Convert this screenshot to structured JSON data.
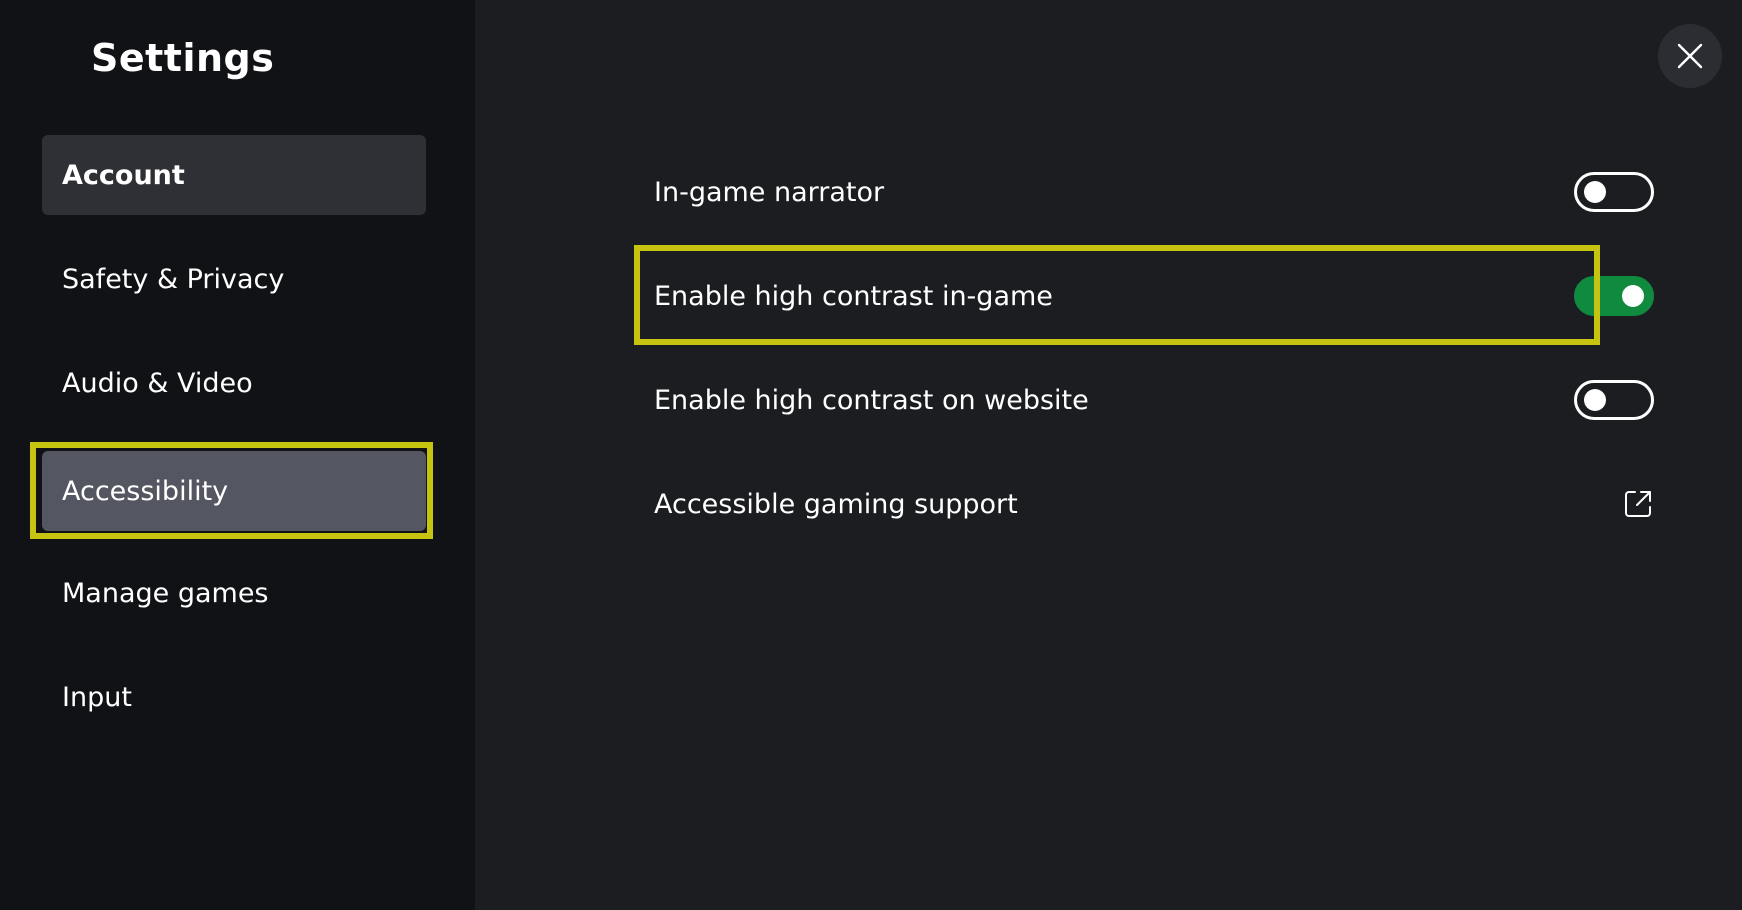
{
  "sidebar": {
    "title": "Settings",
    "items": [
      {
        "label": "Account"
      },
      {
        "label": "Safety & Privacy"
      },
      {
        "label": "Audio & Video"
      },
      {
        "label": "Accessibility"
      },
      {
        "label": "Manage games"
      },
      {
        "label": "Input"
      }
    ],
    "active_item": "Account",
    "focused_item": "Accessibility"
  },
  "header": {
    "close_icon": "close-icon"
  },
  "settings": [
    {
      "label": "In-game narrator",
      "control": "toggle",
      "value": "off"
    },
    {
      "label": "Enable high contrast in-game",
      "control": "toggle",
      "value": "on"
    },
    {
      "label": "Enable high contrast on website",
      "control": "toggle",
      "value": "off"
    },
    {
      "label": "Accessible gaming support",
      "control": "external-link",
      "icon": "external-link-icon"
    }
  ],
  "colors": {
    "sidebar_bg": "#111216",
    "main_bg": "#1c1d21",
    "focus_ring": "#c6c311",
    "toggle_on": "#0f8a3e",
    "active_item_bg": "#2f3036",
    "focused_item_bg": "#545761"
  }
}
